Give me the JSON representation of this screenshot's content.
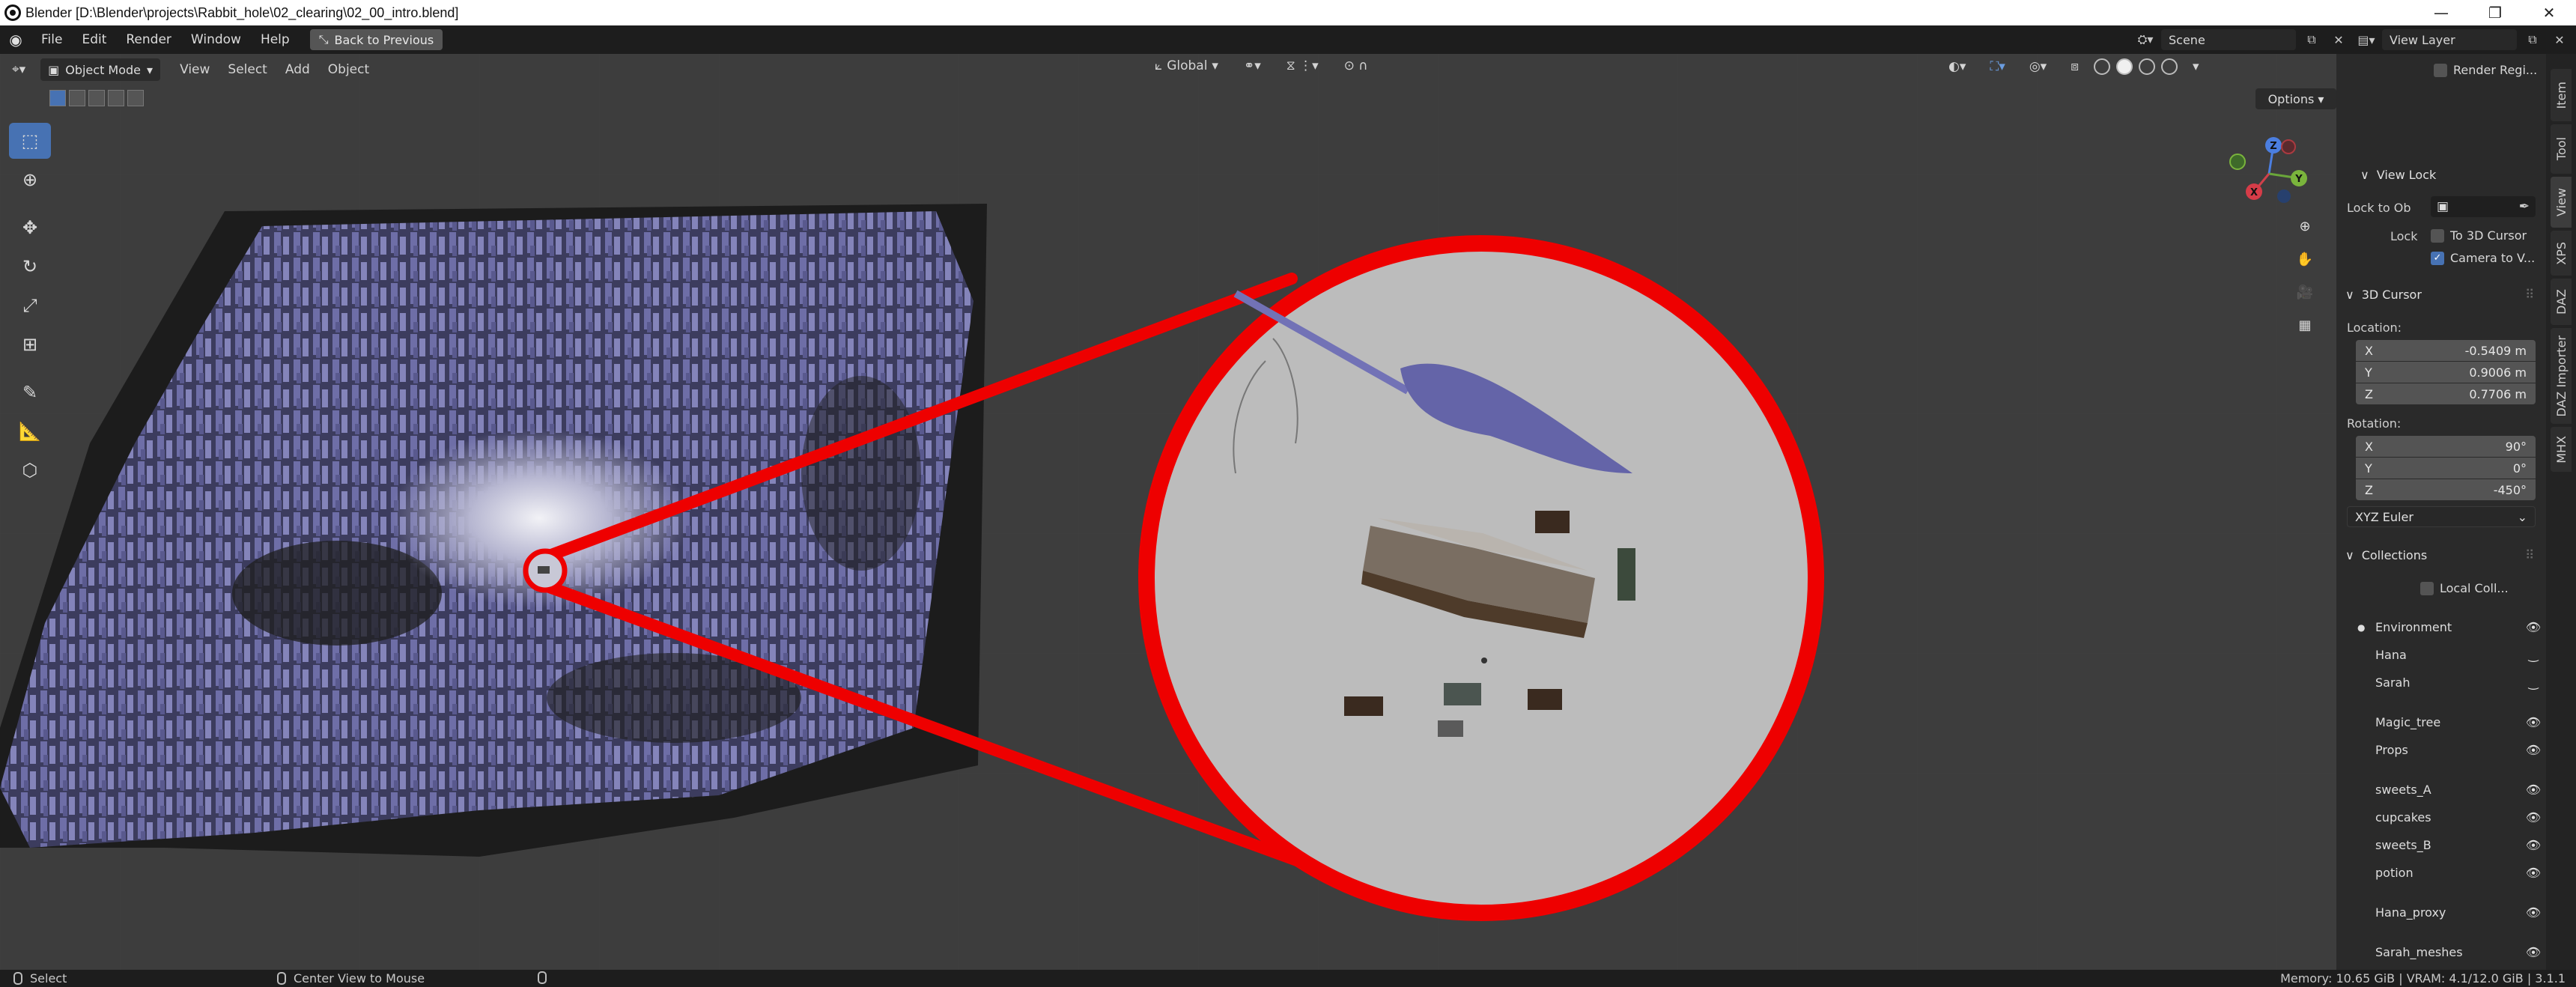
{
  "window": {
    "title": "Blender [D:\\Blender\\projects\\Rabbit_hole\\02_clearing\\02_00_intro.blend]",
    "controls": [
      "—",
      "❐",
      "✕"
    ]
  },
  "topbar": {
    "menus": [
      "File",
      "Edit",
      "Render",
      "Window",
      "Help"
    ],
    "back_button": "Back to Previous",
    "scene": "Scene",
    "view_layer": "View Layer"
  },
  "viewport": {
    "mode": "Object Mode",
    "menus": [
      "View",
      "Select",
      "Add",
      "Object"
    ],
    "orientation": "Global",
    "options_label": "Options",
    "gizmo": {
      "z": "Z",
      "y": "Y",
      "x": "X"
    }
  },
  "sidebar": {
    "render_region": "Render Regi...",
    "view_lock": {
      "title": "View Lock",
      "lock_to_object_label": "Lock to Ob",
      "lock_label": "Lock",
      "to_3d_cursor": "To 3D Cursor",
      "to_3d_cursor_checked": false,
      "camera_to_view": "Camera to V...",
      "camera_to_view_checked": true
    },
    "cursor": {
      "title": "3D Cursor",
      "location_label": "Location:",
      "location": [
        {
          "axis": "X",
          "value": "-0.5409 m"
        },
        {
          "axis": "Y",
          "value": "0.9006 m"
        },
        {
          "axis": "Z",
          "value": "0.7706 m"
        }
      ],
      "rotation_label": "Rotation:",
      "rotation": [
        {
          "axis": "X",
          "value": "90°"
        },
        {
          "axis": "Y",
          "value": "0°"
        },
        {
          "axis": "Z",
          "value": "-450°"
        }
      ],
      "rotation_mode": "XYZ Euler"
    },
    "collections": {
      "title": "Collections",
      "local_collections": "Local Coll...",
      "items": [
        {
          "name": "Environment",
          "active": true,
          "visible": true
        },
        {
          "name": "Hana",
          "active": false,
          "visible": false
        },
        {
          "name": "Sarah",
          "active": false,
          "visible": false
        },
        {
          "name": "Magic_tree",
          "active": false,
          "visible": true
        },
        {
          "name": "Props",
          "active": false,
          "visible": true
        },
        {
          "name": "sweets_A",
          "active": false,
          "visible": true
        },
        {
          "name": "cupcakes",
          "active": false,
          "visible": true
        },
        {
          "name": "sweets_B",
          "active": false,
          "visible": true
        },
        {
          "name": "potion",
          "active": false,
          "visible": true
        },
        {
          "name": "Hana_proxy",
          "active": false,
          "visible": true
        },
        {
          "name": "Sarah_meshes",
          "active": false,
          "visible": true
        }
      ]
    },
    "tabs": [
      "Item",
      "Tool",
      "View",
      "XPS",
      "DAZ",
      "DAZ Importer",
      "MHX"
    ],
    "active_tab": "View"
  },
  "statusbar": {
    "left": "Select",
    "middle": "Center View to Mouse",
    "right": "Memory: 10.65 GiB | VRAM: 4.1/12.0 GiB | 3.1.1"
  },
  "colors": {
    "accent": "#4772b3",
    "highlight_circle": "#ee0000",
    "forest": "#6a6aa6",
    "ground": "#1e1e1e"
  }
}
